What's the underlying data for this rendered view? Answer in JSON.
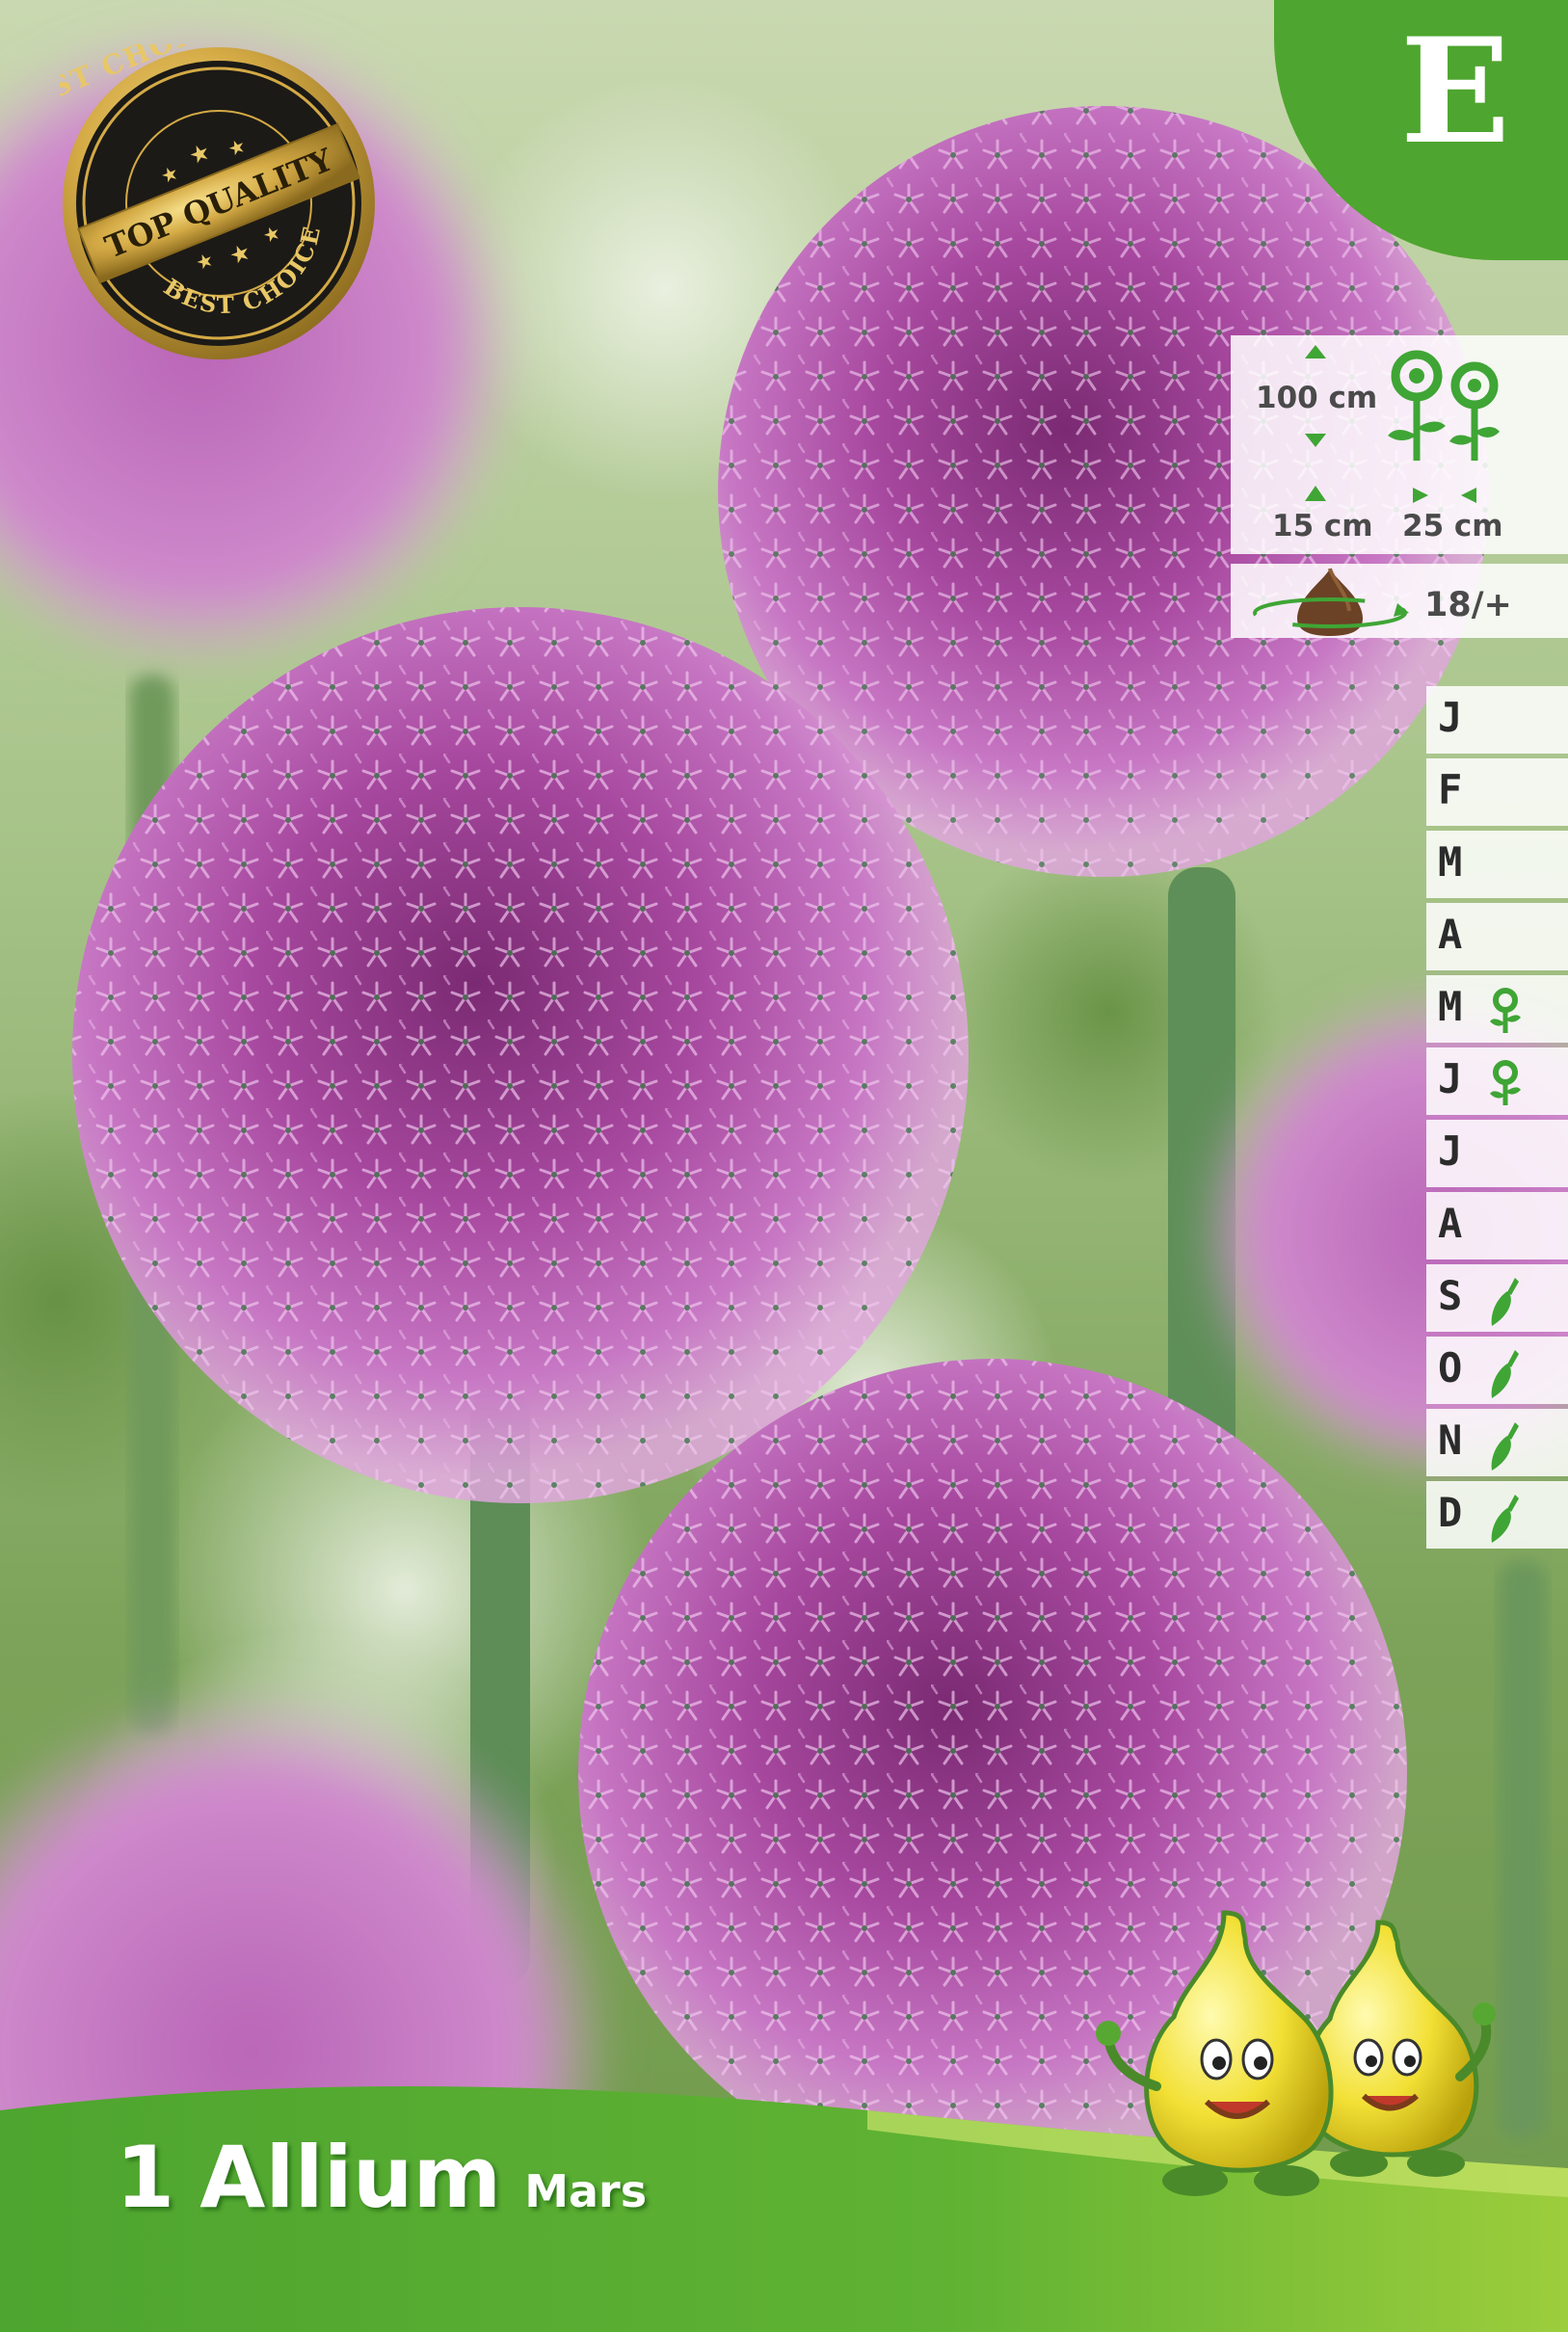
{
  "package": {
    "category_letter": "E",
    "seal": {
      "top_text": "BEST CHOICE",
      "center_text": "TOP QUALITY",
      "bottom_text": "BEST CHOICE"
    }
  },
  "plant_info": {
    "height": "100 cm",
    "planting_depth": "15 cm",
    "plant_spacing": "25 cm",
    "bulb_size": "18/+",
    "icons": {
      "height": "vertical-arrows-icon",
      "depth": "vertical-arrows-icon",
      "spacing": "horizontal-arrows-icon",
      "plants": "two-flowers-icon",
      "bulb": "bulb-circumference-icon"
    }
  },
  "calendar": {
    "months": [
      {
        "letter": "J",
        "icon": ""
      },
      {
        "letter": "F",
        "icon": ""
      },
      {
        "letter": "M",
        "icon": ""
      },
      {
        "letter": "A",
        "icon": ""
      },
      {
        "letter": "M",
        "icon": "flower-icon"
      },
      {
        "letter": "J",
        "icon": "flower-icon"
      },
      {
        "letter": "J",
        "icon": ""
      },
      {
        "letter": "A",
        "icon": ""
      },
      {
        "letter": "S",
        "icon": "trowel-icon"
      },
      {
        "letter": "O",
        "icon": "trowel-icon"
      },
      {
        "letter": "N",
        "icon": "trowel-icon"
      },
      {
        "letter": "D",
        "icon": "trowel-icon"
      }
    ]
  },
  "product": {
    "count": "1",
    "name": "Allium",
    "variety": "Mars"
  },
  "colors": {
    "brand_green": "#4ea52f",
    "banner_light_green": "#8cc63f",
    "flower_purple": "#b04fb0",
    "icon_green": "#3fa535",
    "seal_gold": "#c9a23a"
  }
}
